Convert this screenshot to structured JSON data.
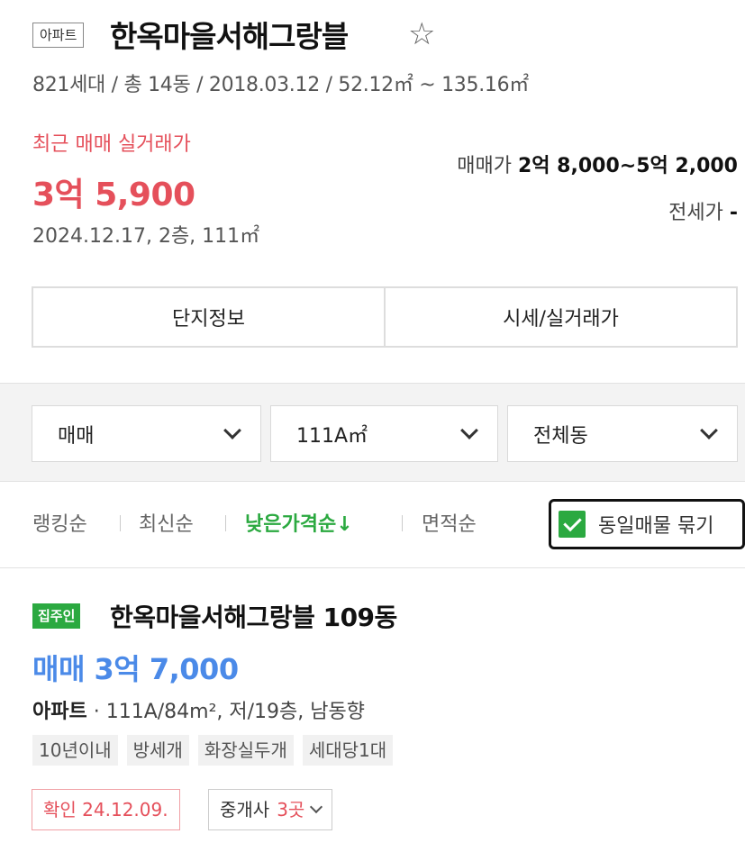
{
  "header": {
    "type_badge": "아파트",
    "complex_name": "한옥마을서해그랑블",
    "star_glyph": "☆",
    "summary": "821세대 / 총 14동 / 2018.03.12 / 52.12㎡ ~ 135.16㎡"
  },
  "recent_trade": {
    "label": "최근 매매 실거래가",
    "price": "3억 5,900",
    "info": "2024.12.17, 2층, 111㎡"
  },
  "price_range": {
    "sale_label": "매매가",
    "sale_value": "2억 8,000~5억 2,000",
    "jeonse_label": "전세가",
    "jeonse_value": "-"
  },
  "info_tabs": [
    "단지정보",
    "시세/실거래가"
  ],
  "filters": {
    "trade_type": "매매",
    "area": "111A㎡",
    "dong": "전체동"
  },
  "sort": {
    "options": [
      "랭킹순",
      "최신순",
      "낮은가격순↓",
      "면적순"
    ],
    "active_index": 2,
    "group_same_label": "동일매물 묶기",
    "group_same_checked": true
  },
  "listing": {
    "badge": "집주인",
    "title": "한옥마을서해그랑블 109동",
    "price": "매매 3억 7,000",
    "spec_type": "아파트",
    "spec_detail": "· 111A/84m², 저/19층, 남동향",
    "tags": [
      "10년이내",
      "방세개",
      "화장실두개",
      "세대당1대"
    ],
    "confirmed": "확인 24.12.09.",
    "brokers_label": "중개사",
    "brokers_count": "3곳"
  },
  "colors": {
    "price_red": "#e5505b",
    "accent_green": "#2ba940",
    "price_blue": "#4b8ae8"
  }
}
